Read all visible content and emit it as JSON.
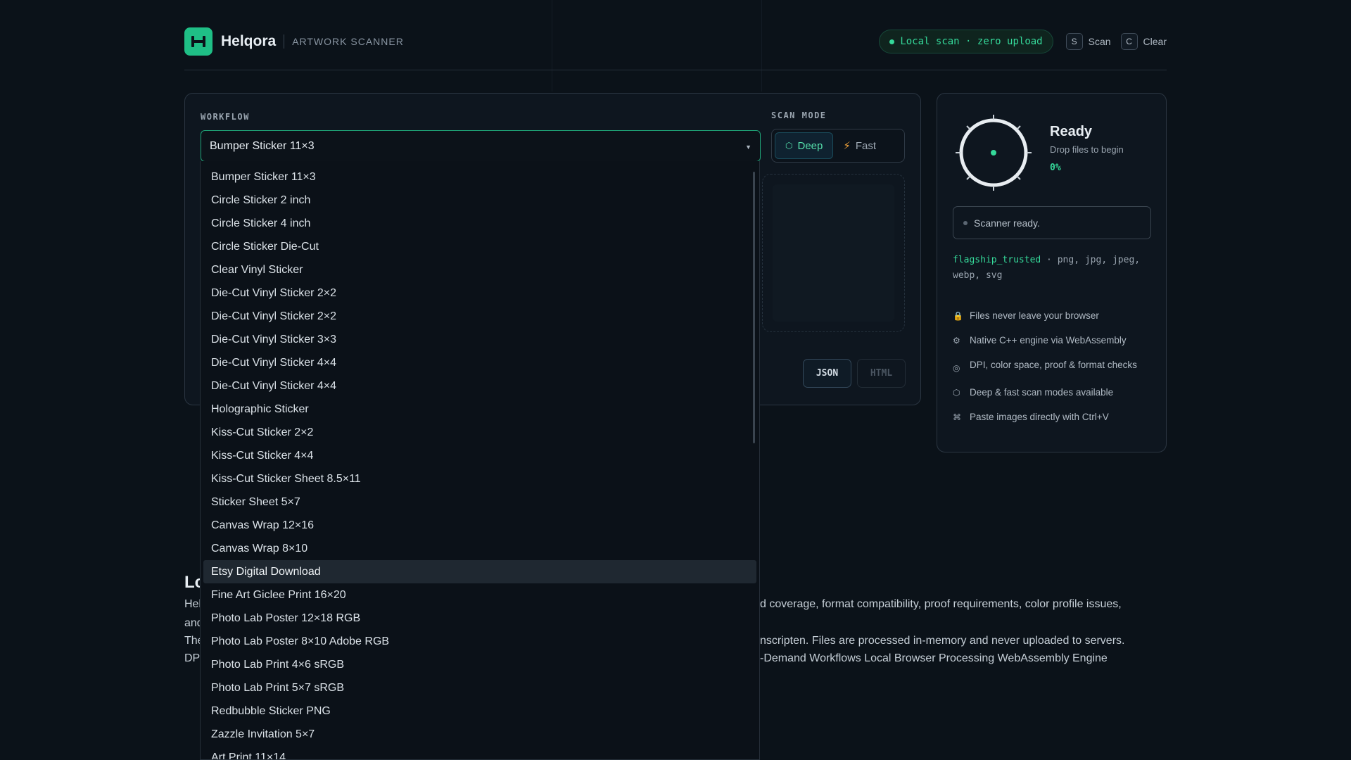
{
  "header": {
    "brand": "Helqora",
    "subtitle": "ARTWORK SCANNER",
    "status_pill": "Local scan · zero upload",
    "shortcuts": [
      {
        "key": "S",
        "label": "Scan"
      },
      {
        "key": "C",
        "label": "Clear"
      }
    ]
  },
  "workflow": {
    "label": "WORKFLOW",
    "selected": "Bumper Sticker 11×3",
    "options": [
      "Bumper Sticker 11×3",
      "Circle Sticker 2 inch",
      "Circle Sticker 4 inch",
      "Circle Sticker Die-Cut",
      "Clear Vinyl Sticker",
      "Die-Cut Vinyl Sticker 2×2",
      "Die-Cut Vinyl Sticker 2×2",
      "Die-Cut Vinyl Sticker 3×3",
      "Die-Cut Vinyl Sticker 4×4",
      "Die-Cut Vinyl Sticker 4×4",
      "Holographic Sticker",
      "Kiss-Cut Sticker 2×2",
      "Kiss-Cut Sticker 4×4",
      "Kiss-Cut Sticker Sheet 8.5×11",
      "Sticker Sheet 5×7",
      "Canvas Wrap 12×16",
      "Canvas Wrap 8×10",
      "Etsy Digital Download",
      "Fine Art Giclee Print 16×20",
      "Photo Lab Poster 12×18 RGB",
      "Photo Lab Poster 8×10 Adobe RGB",
      "Photo Lab Print 4×6 sRGB",
      "Photo Lab Print 5×7 sRGB",
      "Redbubble Sticker PNG",
      "Zazzle Invitation 5×7",
      "Art Print 11×14"
    ],
    "highlighted_index": 17
  },
  "scan_mode": {
    "label": "SCAN MODE",
    "deep": "Deep",
    "fast": "Fast"
  },
  "export": {
    "json": "JSON",
    "html": "HTML"
  },
  "status": {
    "title": "Ready",
    "subtitle": "Drop files to begin",
    "percent": "0%",
    "message": "Scanner ready.",
    "profile": "flagship_trusted",
    "formats": " · png, jpg, jpeg, webp, svg"
  },
  "features": [
    {
      "icon": "lock-icon",
      "text": "Files never leave your browser"
    },
    {
      "icon": "gear-icon",
      "text": "Native C++ engine via WebAssembly"
    },
    {
      "icon": "target-icon",
      "text": "DPI, color space, proof & format checks"
    },
    {
      "icon": "hexagon-icon",
      "text": "Deep & fast scan modes available"
    },
    {
      "icon": "command-icon",
      "text": "Paste images directly with Ctrl+V"
    }
  ],
  "below": {
    "title_fragment": "Lo",
    "left_fragments": [
      "Hel",
      "and",
      "The",
      "DPI"
    ],
    "line1_right": "d coverage, format compatibility, proof requirements, color profile issues,",
    "line3_right": "nscripten. Files are processed in-memory and never uploaded to servers.",
    "line4_right": "-Demand Workflows Local Browser Processing WebAssembly Engine"
  },
  "colors": {
    "accent": "#1fbf86",
    "accent_text": "#35d99a",
    "background": "#0b1219"
  }
}
